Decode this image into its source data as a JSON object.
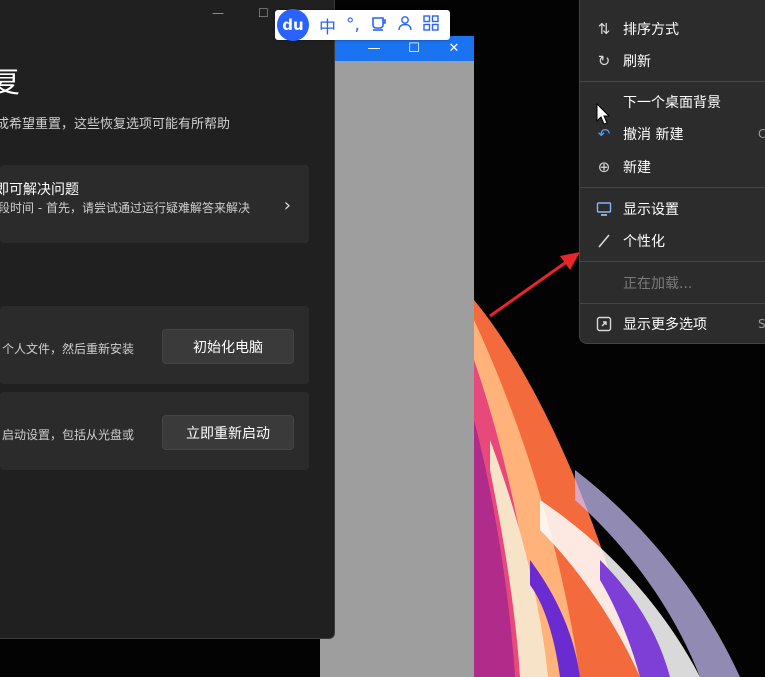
{
  "settings_window": {
    "title_fragment": "复",
    "description": "成希望重置，这些恢复选项可能有所帮助",
    "troubleshoot": {
      "title": "即可解决问题",
      "subtitle": "段时间 - 首先，请尝试通过运行疑难解答来解决"
    },
    "reset": {
      "subtitle": "个人文件，然后重新安装",
      "button": "初始化电脑"
    },
    "advanced": {
      "subtitle": "启动设置，包括从光盘或",
      "button": "立即重新启动"
    }
  },
  "ime_toolbar": {
    "logo": "du",
    "lang": "中",
    "punct": "°,",
    "icons": [
      "cup-icon",
      "user-icon",
      "grid-icon"
    ]
  },
  "context_menu": {
    "items": [
      {
        "label": "排序方式",
        "icon": "sort-icon"
      },
      {
        "label": "刷新",
        "icon": "refresh-icon"
      },
      {
        "label": "下一个桌面背景",
        "icon": "none"
      },
      {
        "label": "撤消 新建",
        "icon": "undo-icon",
        "shortcut": "C"
      },
      {
        "label": "新建",
        "icon": "plus-circle-icon"
      },
      {
        "label": "显示设置",
        "icon": "display-icon"
      },
      {
        "label": "个性化",
        "icon": "brush-icon"
      },
      {
        "label": "正在加载...",
        "icon": "none",
        "disabled": true
      },
      {
        "label": "显示更多选项",
        "icon": "expand-icon",
        "shortcut": "S"
      }
    ]
  },
  "colors": {
    "accent_blue": "#1a73f0",
    "annotation_red": "#e5262a"
  }
}
